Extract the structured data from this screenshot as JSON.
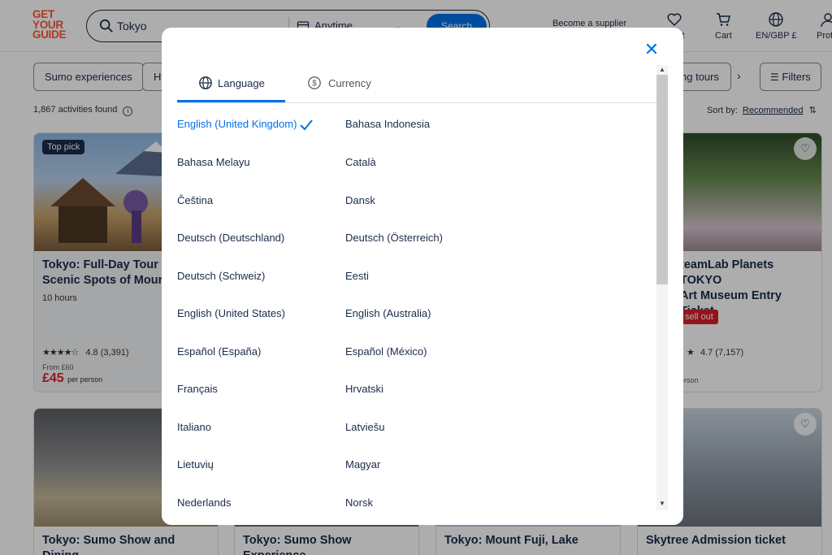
{
  "header": {
    "logo_lines": [
      "GET",
      "YOUR",
      "GUIDE"
    ],
    "search_value": "Tokyo",
    "date_label": "Anytime",
    "search_button": "Search",
    "supplier_link": "Become a supplier",
    "nav": [
      {
        "label": "Wishlist",
        "visible_label": "st",
        "icon": "heart-icon"
      },
      {
        "label": "Cart",
        "icon": "cart-icon"
      },
      {
        "label": "EN/GBP £",
        "icon": "globe-icon"
      },
      {
        "label": "Prof",
        "icon": "user-icon"
      }
    ]
  },
  "chips": [
    {
      "label": "Sumo experiences"
    },
    {
      "label": "H"
    },
    {
      "label": "ng tours"
    }
  ],
  "filters_label": "Filters",
  "results_count": "1,867 activities found",
  "sort": {
    "label": "Sort by:",
    "value": "Recommended"
  },
  "cards": [
    {
      "badge": "Top pick",
      "title_lines": [
        "Tokyo: Full-Day Tour to",
        "Scenic Spots of Mount F"
      ],
      "duration": "10 hours",
      "rating": "4.8",
      "reviews": "(3,391)",
      "from": "From £60",
      "price": "£45",
      "price_unit": "per person"
    },
    {
      "title_lines": [
        "teamLab Planets TOKYO",
        "Art Museum Entry Ticket"
      ],
      "sellout": "sell out",
      "rating": "4.7",
      "reviews": "(7,157)",
      "price_unit": "erson"
    },
    {
      "title_lines": [
        "Tokyo: Sumo Show and Dining"
      ]
    },
    {
      "title_lines": [
        "Tokyo: Sumo Show Experience"
      ]
    },
    {
      "title_lines": [
        "Tokyo: Mount Fuji, Lake"
      ]
    },
    {
      "title_lines": [
        "Skytree Admission ticket"
      ]
    }
  ],
  "modal": {
    "tabs": [
      {
        "label": "Language",
        "active": true,
        "icon": "globe-icon"
      },
      {
        "label": "Currency",
        "active": false,
        "icon": "dollar-circle-icon"
      }
    ],
    "languages": [
      {
        "name": "English (United Kingdom)",
        "selected": true
      },
      {
        "name": "Bahasa Indonesia"
      },
      {
        "name": "Bahasa Melayu"
      },
      {
        "name": "Català"
      },
      {
        "name": "Čeština"
      },
      {
        "name": "Dansk"
      },
      {
        "name": "Deutsch (Deutschland)"
      },
      {
        "name": "Deutsch (Österreich)"
      },
      {
        "name": "Deutsch (Schweiz)"
      },
      {
        "name": "Eesti"
      },
      {
        "name": "English (United States)"
      },
      {
        "name": "English (Australia)"
      },
      {
        "name": "Español (España)"
      },
      {
        "name": "Español (México)"
      },
      {
        "name": "Français"
      },
      {
        "name": "Hrvatski"
      },
      {
        "name": "Italiano"
      },
      {
        "name": "Latviešu"
      },
      {
        "name": "Lietuvių"
      },
      {
        "name": "Magyar"
      },
      {
        "name": "Nederlands"
      },
      {
        "name": "Norsk"
      }
    ]
  },
  "colors": {
    "brand": "#ff5533",
    "accent": "#0071eb",
    "text": "#1a2b49",
    "price": "#d22222"
  }
}
